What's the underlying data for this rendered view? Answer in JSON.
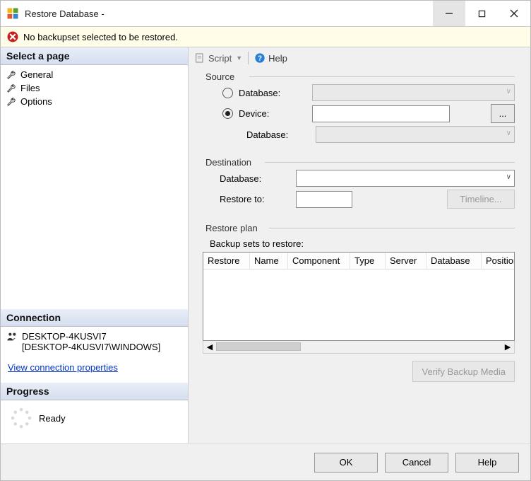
{
  "title": "Restore Database -",
  "warning": "No backupset selected to be restored.",
  "sidebar": {
    "select_page": "Select a page",
    "pages": [
      "General",
      "Files",
      "Options"
    ],
    "connection_hdr": "Connection",
    "server": "DESKTOP-4KUSVI7",
    "login": "[DESKTOP-4KUSVI7\\WINDOWS]",
    "view_conn": "View connection properties",
    "progress_hdr": "Progress",
    "progress_text": "Ready"
  },
  "toolbar": {
    "script": "Script",
    "help": "Help"
  },
  "source": {
    "legend": "Source",
    "radio_database": "Database:",
    "radio_device": "Device:",
    "ellipsis": "...",
    "db_label": "Database:"
  },
  "dest": {
    "legend": "Destination",
    "db_label": "Database:",
    "restore_to": "Restore to:",
    "timeline": "Timeline..."
  },
  "plan": {
    "legend": "Restore plan",
    "subtitle": "Backup sets to restore:",
    "columns": [
      "Restore",
      "Name",
      "Component",
      "Type",
      "Server",
      "Database",
      "Position"
    ],
    "verify": "Verify Backup Media"
  },
  "footer": {
    "ok": "OK",
    "cancel": "Cancel",
    "help": "Help"
  },
  "chart_data": {
    "type": "table",
    "columns": [
      "Restore",
      "Name",
      "Component",
      "Type",
      "Server",
      "Database",
      "Position"
    ],
    "rows": []
  }
}
